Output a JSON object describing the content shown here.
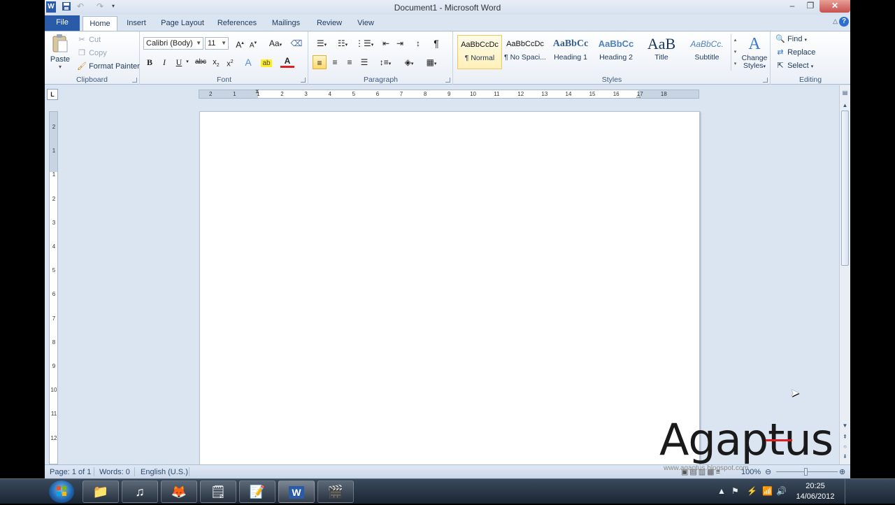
{
  "window": {
    "title": "Document1 - Microsoft Word",
    "close_icon": "close-icon",
    "maximize_icon": "maximize-icon",
    "minimize_icon": "minimize-icon"
  },
  "qat": {
    "save": "save-icon",
    "undo": "undo-icon",
    "redo": "redo-icon",
    "customize": "customize-icon",
    "app": "word-icon"
  },
  "tabs": [
    {
      "label": "File"
    },
    {
      "label": "Home",
      "selected": true
    },
    {
      "label": "Insert"
    },
    {
      "label": "Page Layout"
    },
    {
      "label": "References"
    },
    {
      "label": "Mailings"
    },
    {
      "label": "Review"
    },
    {
      "label": "View"
    }
  ],
  "ribbon": {
    "clipboard": {
      "label": "Clipboard",
      "paste": "Paste",
      "cut": "Cut",
      "copy": "Copy",
      "format_painter": "Format Painter"
    },
    "font": {
      "label": "Font",
      "family": "Calibri (Body)",
      "size": "11"
    },
    "paragraph": {
      "label": "Paragraph"
    },
    "styles": {
      "label": "Styles",
      "items": [
        {
          "preview": "AaBbCcDc",
          "name": "¶ Normal",
          "selected": true
        },
        {
          "preview": "AaBbCcDc",
          "name": "¶ No Spaci..."
        },
        {
          "preview": "AaBbCc",
          "name": "Heading 1"
        },
        {
          "preview": "AaBbCc",
          "name": "Heading 2"
        },
        {
          "preview": "AaB",
          "name": "Title"
        },
        {
          "preview": "AaBbCc.",
          "name": "Subtitle"
        }
      ],
      "change_styles_line1": "Change",
      "change_styles_line2": "Styles"
    },
    "editing": {
      "label": "Editing",
      "find": "Find",
      "replace": "Replace",
      "select": "Select"
    }
  },
  "ruler": {
    "horizontal": [
      "2",
      "1",
      "1",
      "2",
      "3",
      "4",
      "5",
      "6",
      "7",
      "8",
      "9",
      "10",
      "11",
      "12",
      "13",
      "14",
      "15",
      "16",
      "17",
      "18"
    ],
    "vertical": [
      "2",
      "1",
      "1",
      "2",
      "3",
      "4",
      "5",
      "6",
      "7",
      "8",
      "9",
      "10",
      "11",
      "12"
    ],
    "tab_selector": "L"
  },
  "statusbar": {
    "page": "Page: 1 of 1",
    "words": "Words: 0",
    "language": "English (U.S.)",
    "zoom": "100%"
  },
  "watermark": {
    "text": "Agaptus",
    "url": "www.agaptus.blogspot.com"
  },
  "taskbar": {
    "apps": [
      "explorer-icon",
      "itunes-icon",
      "firefox-icon",
      "sticky-notes-icon",
      "notes-icon",
      "word-icon",
      "video-icon"
    ],
    "time": "20:25",
    "date": "14/06/2012"
  }
}
